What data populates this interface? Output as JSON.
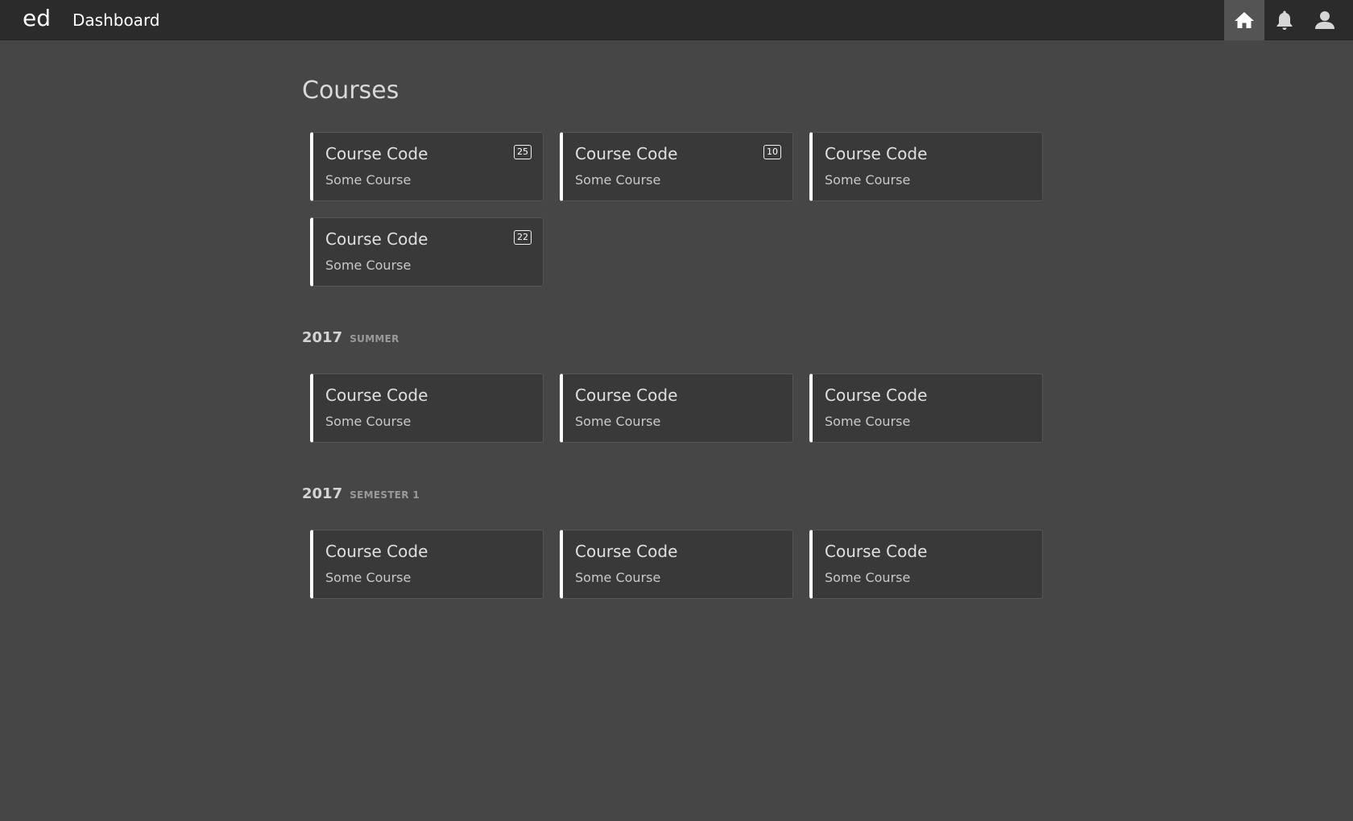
{
  "app": {
    "logo": "ed",
    "title": "Dashboard"
  },
  "nav": {
    "icons": [
      "home-icon",
      "bell-icon",
      "user-icon"
    ],
    "active": "home"
  },
  "page": {
    "title": "Courses"
  },
  "courses": [
    {
      "code": "Course Code",
      "name": "Some Course",
      "badge": "25"
    },
    {
      "code": "Course Code",
      "name": "Some Course",
      "badge": "10"
    },
    {
      "code": "Course Code",
      "name": "Some Course",
      "badge": ""
    },
    {
      "code": "Course Code",
      "name": "Some Course",
      "badge": "22"
    }
  ],
  "sections": [
    {
      "year": "2017",
      "term": "SUMMER",
      "courses": [
        {
          "code": "Course Code",
          "name": "Some Course"
        },
        {
          "code": "Course Code",
          "name": "Some Course"
        },
        {
          "code": "Course Code",
          "name": "Some Course"
        }
      ]
    },
    {
      "year": "2017",
      "term": "SEMESTER 1",
      "courses": [
        {
          "code": "Course Code",
          "name": "Some Course"
        },
        {
          "code": "Course Code",
          "name": "Some Course"
        },
        {
          "code": "Course Code",
          "name": "Some Course"
        }
      ]
    }
  ],
  "colors": {
    "topbar": "#2b2b2b",
    "background": "#464646",
    "card": "#393939",
    "card_accent": "#ffffff",
    "nav_active": "#545454"
  }
}
